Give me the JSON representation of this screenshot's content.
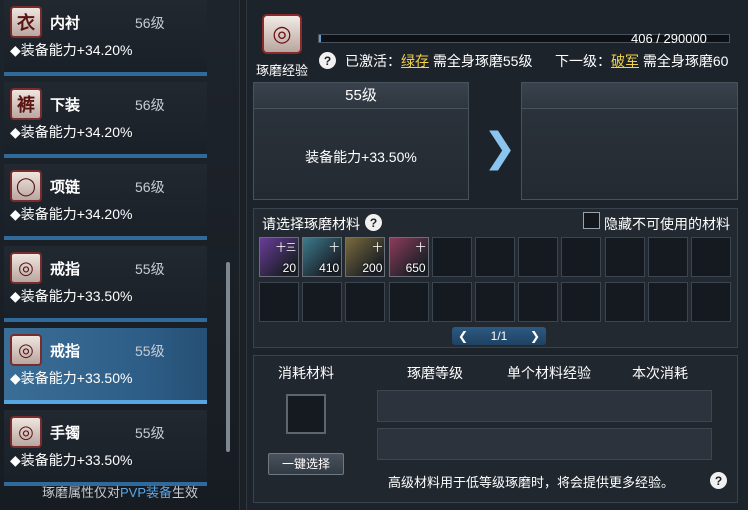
{
  "equipment_list": [
    {
      "name": "内衬",
      "level": "56级",
      "ability": "◆装备能力+34.20%",
      "icon": "shirt-icon",
      "glyph": "衣"
    },
    {
      "name": "下装",
      "level": "56级",
      "ability": "◆装备能力+34.20%",
      "icon": "pants-icon",
      "glyph": "裤"
    },
    {
      "name": "项链",
      "level": "56级",
      "ability": "◆装备能力+34.20%",
      "icon": "necklace-icon",
      "glyph": "◯"
    },
    {
      "name": "戒指",
      "level": "55级",
      "ability": "◆装备能力+33.50%",
      "icon": "ring-icon",
      "glyph": "◎"
    },
    {
      "name": "戒指",
      "level": "55级",
      "ability": "◆装备能力+33.50%",
      "icon": "ring-icon",
      "glyph": "◎",
      "selected": true
    },
    {
      "name": "手镯",
      "level": "55级",
      "ability": "◆装备能力+33.50%",
      "icon": "bracelet-icon",
      "glyph": "◎"
    }
  ],
  "footer_note": {
    "before": "琢磨属性仅对",
    "highlight": "PVP装备",
    "after": "生效"
  },
  "xp": {
    "label": "琢磨经验",
    "current": 406,
    "max": 290000,
    "text": "406 / 290000",
    "fraction": 0.0014
  },
  "activation": {
    "prefix": "已激活：",
    "name": "绿存",
    "requirement": "需全身琢磨55级"
  },
  "next_level": {
    "prefix": "下一级：",
    "name": "破军",
    "requirement": "需全身琢磨60"
  },
  "current_box": {
    "level": "55级",
    "value": "装备能力+33.50%"
  },
  "next_box": {
    "level": "",
    "value": ""
  },
  "materials": {
    "title": "请选择琢磨材料",
    "hide_label": "隐藏不可使用的材料",
    "items": [
      {
        "count": "20",
        "tag": "十三",
        "color": "#6a3c9a",
        "icon": "blue-gem-icon"
      },
      {
        "count": "410",
        "tag": "十",
        "color": "#3c7a8c",
        "icon": "teal-gem-icon"
      },
      {
        "count": "200",
        "tag": "十",
        "color": "#7a6a3c",
        "icon": "gold-gem-icon"
      },
      {
        "count": "650",
        "tag": "十",
        "color": "#8c3c5a",
        "icon": "red-gem-icon"
      }
    ],
    "pager": "1/1"
  },
  "consume": {
    "headers": [
      "消耗材料",
      "琢磨等级",
      "单个材料经验",
      "本次消耗"
    ],
    "select_button": "一键选择",
    "tip": "高级材料用于低等级琢磨时，将会提供更多经验。"
  },
  "colors": {
    "accent": "#5aa7e8",
    "highlight": "#f2d24a"
  }
}
